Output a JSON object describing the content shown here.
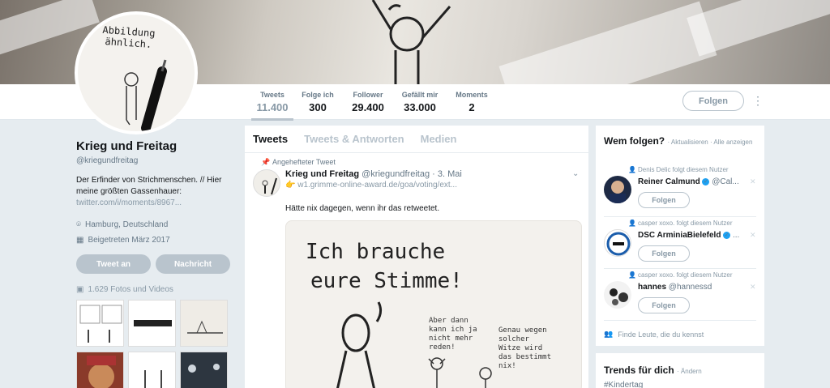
{
  "nav": {
    "stats": [
      {
        "label": "Tweets",
        "value": "11.400"
      },
      {
        "label": "Folge ich",
        "value": "300"
      },
      {
        "label": "Follower",
        "value": "29.400"
      },
      {
        "label": "Gefällt mir",
        "value": "33.000"
      },
      {
        "label": "Moments",
        "value": "2"
      }
    ],
    "follow_label": "Folgen"
  },
  "avatar": {
    "caption_line1": "Abbildung",
    "caption_line2": "ähnlich."
  },
  "profile": {
    "name": "Krieg und Freitag",
    "handle": "@kriegundfreitag",
    "bio": "Der Erfinder von Strichmenschen. // Hier meine größten Gassenhauer:",
    "link": "twitter.com/i/moments/8967...",
    "location": "Hamburg, Deutschland",
    "joined": "Beigetreten März 2017",
    "tweet_to": "Tweet an",
    "message": "Nachricht",
    "photos": "1.629 Fotos und Videos"
  },
  "timeline": {
    "tabs": [
      "Tweets",
      "Tweets & Antworten",
      "Medien"
    ],
    "pinned_label": "Angehefteter Tweet",
    "tweet": {
      "name": "Krieg und Freitag",
      "handle": "@kriegundfreitag · 3. Mai",
      "link": "👉 w1.grimme-online-award.de/goa/voting/ext...",
      "text": "Hätte nix dagegen, wenn ihr das retweetet.",
      "image_line1": "Ich brauche",
      "image_line2": "eure Stimme!",
      "bubble1": "Aber dann kann ich ja nicht mehr reden!",
      "bubble2": "Genau wegen solcher Witze wird das bestimmt nix!"
    }
  },
  "wtf": {
    "title": "Wem folgen?",
    "refresh": "· Aktualisieren · Alle anzeigen",
    "recs": [
      {
        "context": "Denis Delic folgt diesem Nutzer",
        "name": "Reiner Calmund",
        "handle": "@Cal...",
        "follow": "Folgen"
      },
      {
        "context": "casper xoxo. folgt diesem Nutzer",
        "name": "DSC ArminiaBielefeld",
        "handle": "...",
        "follow": "Folgen"
      },
      {
        "context": "casper xoxo. folgt diesem Nutzer",
        "name": "hannes",
        "handle": "@hannessd",
        "follow": "Folgen"
      }
    ],
    "find": "Finde Leute, die du kennst"
  },
  "trends": {
    "title": "Trends für dich",
    "change": "· Ändern",
    "tag": "#Kindertag"
  },
  "colors": {
    "accent": "#1da1f2",
    "muted": "#8899a6",
    "bg": "#e6ecf0"
  }
}
